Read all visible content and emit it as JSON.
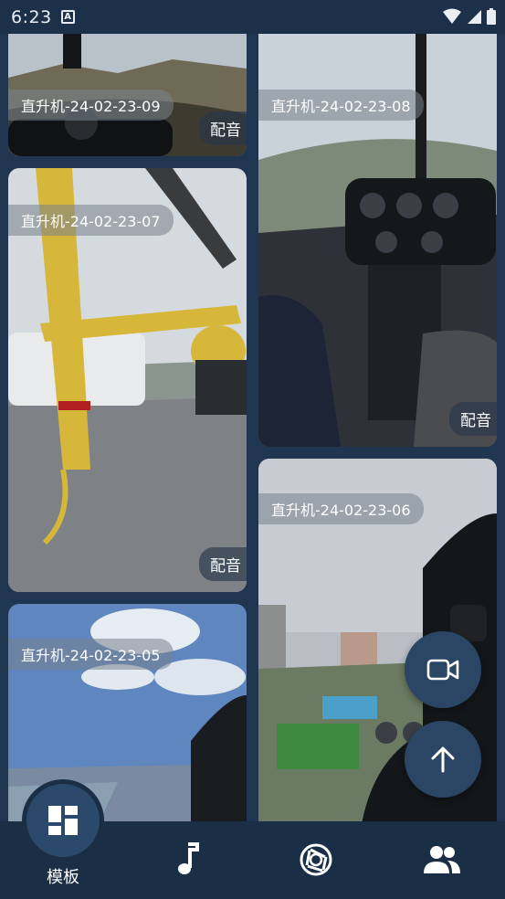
{
  "status_bar": {
    "time": "6:23"
  },
  "cards": [
    {
      "title": "直升机-24-02-23-09",
      "dub_label": "配音"
    },
    {
      "title": "直升机-24-02-23-08",
      "dub_label": "配音"
    },
    {
      "title": "直升机-24-02-23-07",
      "dub_label": "配音"
    },
    {
      "title": "直升机-24-02-23-06",
      "dub_label": ""
    },
    {
      "title": "直升机-24-02-23-05",
      "dub_label": ""
    }
  ],
  "fab": {
    "record_icon": "video-camera-icon",
    "scroll_top_icon": "arrow-up-icon"
  },
  "bottom_nav": {
    "items": [
      {
        "label": "模板",
        "icon": "grid-dashboard-icon",
        "active": true
      },
      {
        "label": "",
        "icon": "music-note-icon",
        "active": false
      },
      {
        "label": "",
        "icon": "camera-aperture-icon",
        "active": false
      },
      {
        "label": "",
        "icon": "people-icon",
        "active": false
      }
    ]
  },
  "colors": {
    "background": "#1f3550",
    "nav_bar": "#1a2e46",
    "fab": "#2a4664"
  }
}
